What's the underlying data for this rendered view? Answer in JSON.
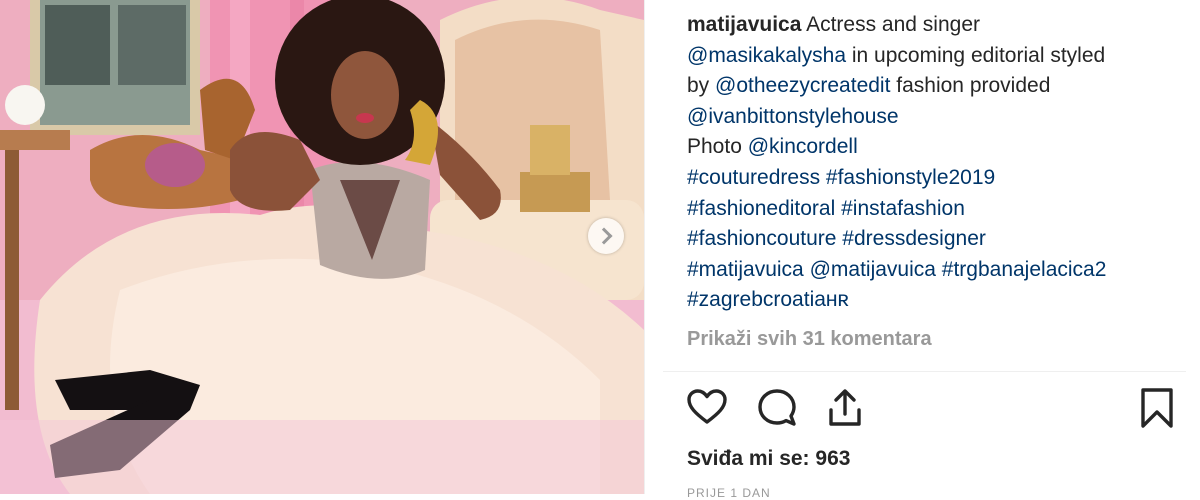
{
  "post": {
    "username": "matijavuica",
    "caption_lines": [
      [
        {
          "t": "user",
          "v": "matijavuica"
        },
        {
          "t": "text",
          "v": " Actress and singer"
        }
      ],
      [
        {
          "t": "link",
          "v": "@masikakalysha"
        },
        {
          "t": "text",
          "v": " in upcoming editorial styled"
        }
      ],
      [
        {
          "t": "text",
          "v": "by "
        },
        {
          "t": "link",
          "v": "@otheezycreatedit"
        },
        {
          "t": "text",
          "v": " fashion provided"
        }
      ],
      [
        {
          "t": "link",
          "v": "@ivanbittonstylehouse"
        }
      ],
      [
        {
          "t": "text",
          "v": "Photo "
        },
        {
          "t": "link",
          "v": "@kincordell"
        }
      ],
      [
        {
          "t": "link",
          "v": "#couturedress"
        },
        {
          "t": "text",
          "v": " "
        },
        {
          "t": "link",
          "v": "#fashionstyle2019"
        }
      ],
      [
        {
          "t": "link",
          "v": "#fashioneditoral"
        },
        {
          "t": "text",
          "v": " "
        },
        {
          "t": "link",
          "v": "#instafashion"
        }
      ],
      [
        {
          "t": "link",
          "v": "#fashioncouture"
        },
        {
          "t": "text",
          "v": " "
        },
        {
          "t": "link",
          "v": "#dressdesigner"
        }
      ],
      [
        {
          "t": "link",
          "v": "#matijavuica"
        },
        {
          "t": "text",
          "v": " "
        },
        {
          "t": "link",
          "v": "@matijavuica"
        },
        {
          "t": "text",
          "v": " "
        },
        {
          "t": "link",
          "v": "#trgbanajelacica2"
        }
      ],
      [
        {
          "t": "link",
          "v": "#zagrebcroatiaʜʀ"
        }
      ]
    ],
    "view_comments_label": "Prikaži svih 31 komentara",
    "likes_label": "Sviđa mi se: 963",
    "date_label": "PRIJE 1 DAN"
  },
  "icons": {
    "like": "heart-icon",
    "comment": "comment-icon",
    "share": "share-icon",
    "save": "bookmark-icon",
    "next": "chevron-right-icon"
  },
  "colors": {
    "link": "#003569",
    "text": "#262626",
    "muted": "#999999",
    "divider": "#efefef"
  }
}
